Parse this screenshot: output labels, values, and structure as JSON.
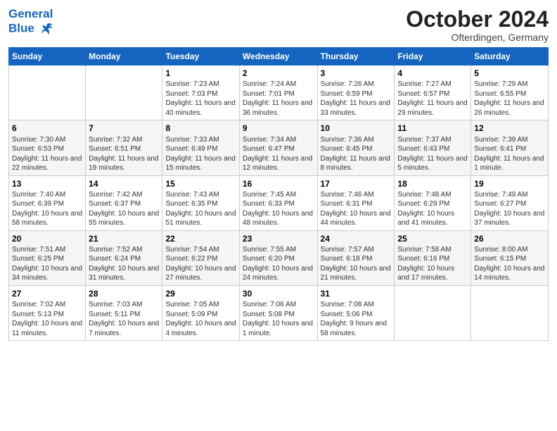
{
  "header": {
    "logo_line1": "General",
    "logo_line2": "Blue",
    "month": "October 2024",
    "location": "Ofterdingen, Germany"
  },
  "weekdays": [
    "Sunday",
    "Monday",
    "Tuesday",
    "Wednesday",
    "Thursday",
    "Friday",
    "Saturday"
  ],
  "weeks": [
    [
      {
        "day": "",
        "info": ""
      },
      {
        "day": "",
        "info": ""
      },
      {
        "day": "1",
        "info": "Sunrise: 7:23 AM\nSunset: 7:03 PM\nDaylight: 11 hours and 40 minutes."
      },
      {
        "day": "2",
        "info": "Sunrise: 7:24 AM\nSunset: 7:01 PM\nDaylight: 11 hours and 36 minutes."
      },
      {
        "day": "3",
        "info": "Sunrise: 7:26 AM\nSunset: 6:59 PM\nDaylight: 11 hours and 33 minutes."
      },
      {
        "day": "4",
        "info": "Sunrise: 7:27 AM\nSunset: 6:57 PM\nDaylight: 11 hours and 29 minutes."
      },
      {
        "day": "5",
        "info": "Sunrise: 7:29 AM\nSunset: 6:55 PM\nDaylight: 11 hours and 26 minutes."
      }
    ],
    [
      {
        "day": "6",
        "info": "Sunrise: 7:30 AM\nSunset: 6:53 PM\nDaylight: 11 hours and 22 minutes."
      },
      {
        "day": "7",
        "info": "Sunrise: 7:32 AM\nSunset: 6:51 PM\nDaylight: 11 hours and 19 minutes."
      },
      {
        "day": "8",
        "info": "Sunrise: 7:33 AM\nSunset: 6:49 PM\nDaylight: 11 hours and 15 minutes."
      },
      {
        "day": "9",
        "info": "Sunrise: 7:34 AM\nSunset: 6:47 PM\nDaylight: 11 hours and 12 minutes."
      },
      {
        "day": "10",
        "info": "Sunrise: 7:36 AM\nSunset: 6:45 PM\nDaylight: 11 hours and 8 minutes."
      },
      {
        "day": "11",
        "info": "Sunrise: 7:37 AM\nSunset: 6:43 PM\nDaylight: 11 hours and 5 minutes."
      },
      {
        "day": "12",
        "info": "Sunrise: 7:39 AM\nSunset: 6:41 PM\nDaylight: 11 hours and 1 minute."
      }
    ],
    [
      {
        "day": "13",
        "info": "Sunrise: 7:40 AM\nSunset: 6:39 PM\nDaylight: 10 hours and 58 minutes."
      },
      {
        "day": "14",
        "info": "Sunrise: 7:42 AM\nSunset: 6:37 PM\nDaylight: 10 hours and 55 minutes."
      },
      {
        "day": "15",
        "info": "Sunrise: 7:43 AM\nSunset: 6:35 PM\nDaylight: 10 hours and 51 minutes."
      },
      {
        "day": "16",
        "info": "Sunrise: 7:45 AM\nSunset: 6:33 PM\nDaylight: 10 hours and 48 minutes."
      },
      {
        "day": "17",
        "info": "Sunrise: 7:46 AM\nSunset: 6:31 PM\nDaylight: 10 hours and 44 minutes."
      },
      {
        "day": "18",
        "info": "Sunrise: 7:48 AM\nSunset: 6:29 PM\nDaylight: 10 hours and 41 minutes."
      },
      {
        "day": "19",
        "info": "Sunrise: 7:49 AM\nSunset: 6:27 PM\nDaylight: 10 hours and 37 minutes."
      }
    ],
    [
      {
        "day": "20",
        "info": "Sunrise: 7:51 AM\nSunset: 6:25 PM\nDaylight: 10 hours and 34 minutes."
      },
      {
        "day": "21",
        "info": "Sunrise: 7:52 AM\nSunset: 6:24 PM\nDaylight: 10 hours and 31 minutes."
      },
      {
        "day": "22",
        "info": "Sunrise: 7:54 AM\nSunset: 6:22 PM\nDaylight: 10 hours and 27 minutes."
      },
      {
        "day": "23",
        "info": "Sunrise: 7:55 AM\nSunset: 6:20 PM\nDaylight: 10 hours and 24 minutes."
      },
      {
        "day": "24",
        "info": "Sunrise: 7:57 AM\nSunset: 6:18 PM\nDaylight: 10 hours and 21 minutes."
      },
      {
        "day": "25",
        "info": "Sunrise: 7:58 AM\nSunset: 6:16 PM\nDaylight: 10 hours and 17 minutes."
      },
      {
        "day": "26",
        "info": "Sunrise: 8:00 AM\nSunset: 6:15 PM\nDaylight: 10 hours and 14 minutes."
      }
    ],
    [
      {
        "day": "27",
        "info": "Sunrise: 7:02 AM\nSunset: 5:13 PM\nDaylight: 10 hours and 11 minutes."
      },
      {
        "day": "28",
        "info": "Sunrise: 7:03 AM\nSunset: 5:11 PM\nDaylight: 10 hours and 7 minutes."
      },
      {
        "day": "29",
        "info": "Sunrise: 7:05 AM\nSunset: 5:09 PM\nDaylight: 10 hours and 4 minutes."
      },
      {
        "day": "30",
        "info": "Sunrise: 7:06 AM\nSunset: 5:08 PM\nDaylight: 10 hours and 1 minute."
      },
      {
        "day": "31",
        "info": "Sunrise: 7:08 AM\nSunset: 5:06 PM\nDaylight: 9 hours and 58 minutes."
      },
      {
        "day": "",
        "info": ""
      },
      {
        "day": "",
        "info": ""
      }
    ]
  ]
}
